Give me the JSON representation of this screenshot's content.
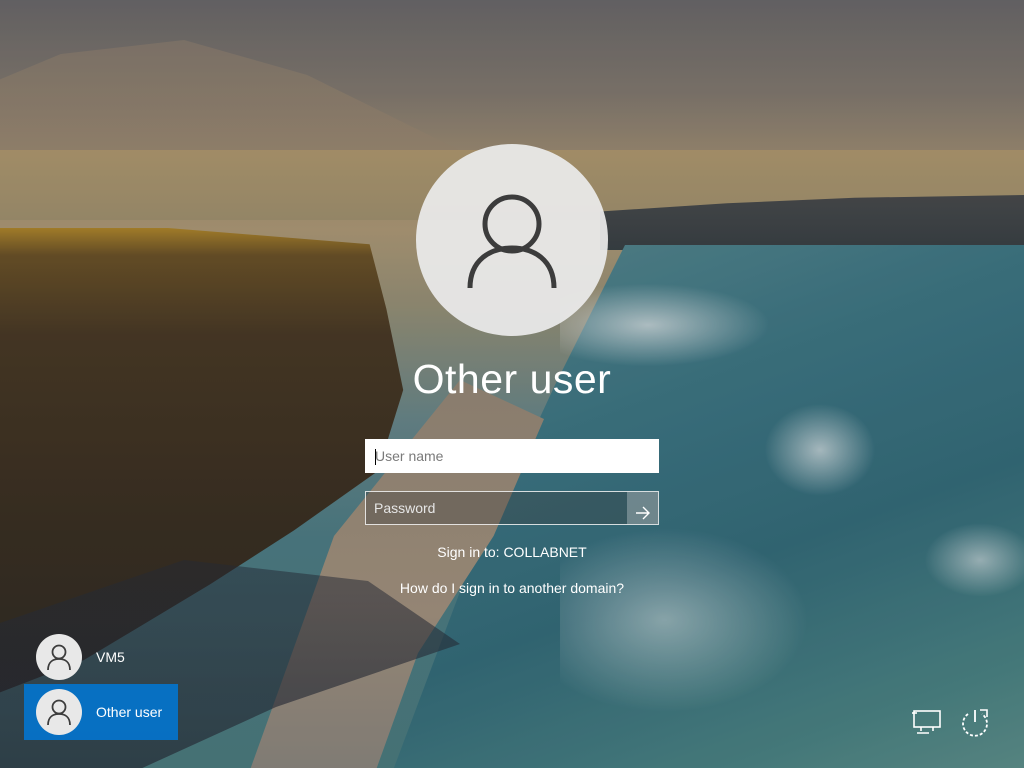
{
  "login": {
    "user_title": "Other user",
    "username_placeholder": "User name",
    "password_placeholder": "Password",
    "sign_in_to": "Sign in to: COLLABNET",
    "help_link": "How do I sign in to another domain?"
  },
  "users": [
    {
      "label": "VM5",
      "selected": false
    },
    {
      "label": "Other user",
      "selected": true
    }
  ],
  "icons": {
    "avatar": "person-icon",
    "submit": "arrow-right-icon",
    "network": "network-icon",
    "power": "power-icon"
  },
  "colors": {
    "selection": "#0078d7",
    "text": "#ffffff"
  }
}
